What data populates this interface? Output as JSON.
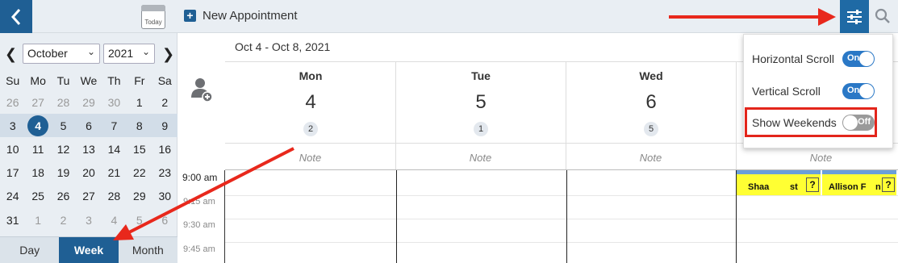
{
  "toolbar": {
    "today_label": "Today",
    "new_appointment_label": "New Appointment"
  },
  "mini_calendar": {
    "month": "October",
    "year": "2021",
    "weekday_headers": [
      "Su",
      "Mo",
      "Tu",
      "We",
      "Th",
      "Fr",
      "Sa"
    ],
    "weeks": [
      [
        "26",
        "27",
        "28",
        "29",
        "30",
        "1",
        "2"
      ],
      [
        "3",
        "4",
        "5",
        "6",
        "7",
        "8",
        "9"
      ],
      [
        "10",
        "11",
        "12",
        "13",
        "14",
        "15",
        "16"
      ],
      [
        "17",
        "18",
        "19",
        "20",
        "21",
        "22",
        "23"
      ],
      [
        "24",
        "25",
        "26",
        "27",
        "28",
        "29",
        "30"
      ],
      [
        "31",
        "1",
        "2",
        "3",
        "4",
        "5",
        "6"
      ]
    ],
    "selected_day": "4"
  },
  "view_tabs": {
    "day": "Day",
    "week": "Week",
    "month": "Month",
    "active": "Week"
  },
  "schedule": {
    "date_range": "Oct 4 - Oct 8, 2021",
    "days": [
      {
        "name": "Mon",
        "date": "4",
        "count": "2"
      },
      {
        "name": "Tue",
        "date": "5",
        "count": "1"
      },
      {
        "name": "Wed",
        "date": "6",
        "count": "5"
      }
    ],
    "note_label": "Note",
    "time_slots": [
      "9:00 am",
      "9:15 am",
      "9:30 am",
      "9:45 am"
    ],
    "appointments": [
      {
        "name": "Shaa",
        "suffix": "st"
      },
      {
        "name": "Allison F",
        "suffix": "n"
      }
    ],
    "appointment_flag": "?"
  },
  "settings_dropdown": {
    "horizontal_scroll": {
      "label": "Horizontal Scroll",
      "state": "On"
    },
    "vertical_scroll": {
      "label": "Vertical Scroll",
      "state": "On"
    },
    "show_weekends": {
      "label": "Show Weekends",
      "state": "Off"
    }
  },
  "colors": {
    "primary": "#1f5f94",
    "toggle_on": "#2a78c6",
    "highlight": "#e3251b",
    "appointment": "#ffff33"
  }
}
